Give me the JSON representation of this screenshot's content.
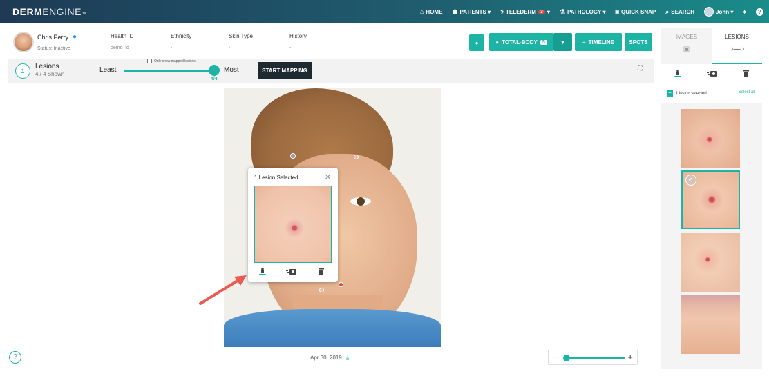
{
  "app": {
    "logo_bold": "DERM",
    "logo_light": "ENGINE",
    "logo_tm": "™"
  },
  "nav": {
    "items": [
      {
        "icon": "home-icon",
        "glyph": "⌂",
        "label": "HOME"
      },
      {
        "icon": "patients-icon",
        "glyph": "☗",
        "label": "PATIENTS ▾"
      },
      {
        "icon": "telederm-icon",
        "glyph": "⚕",
        "label": "TELEDERM",
        "badge": "3",
        "suffix": "▾"
      },
      {
        "icon": "pathology-icon",
        "glyph": "⚗",
        "label": "PATHOLOGY ▾"
      },
      {
        "icon": "camera-icon",
        "glyph": "◙",
        "label": "QUICK SNAP"
      },
      {
        "icon": "search-icon",
        "glyph": "⌕",
        "label": "SEARCH"
      }
    ],
    "user": "John ▾",
    "help": "?"
  },
  "patient": {
    "name": "Chris Perry",
    "status": "Status: Inactive",
    "fields": [
      {
        "label": "Health ID",
        "value": "demo_id"
      },
      {
        "label": "Ethnicity",
        "value": "-"
      },
      {
        "label": "Skin Type",
        "value": "-"
      },
      {
        "label": "History",
        "value": "-"
      }
    ]
  },
  "toolbar": {
    "total_body_label": "TOTAL-BODY",
    "total_body_count": "5",
    "timeline_label": "TIMELINE",
    "spots_label": "SPOTS"
  },
  "mapping": {
    "step": "1",
    "title": "Lesions",
    "subtitle": "4 / 4 Shown",
    "least": "Least",
    "most": "Most",
    "slider_value": "4/4",
    "only_mapped": "Only show mapped lesions",
    "start_button": "START MAPPING"
  },
  "popup": {
    "title": "1 Lesion Selected",
    "close": "✕"
  },
  "footer": {
    "help": "?",
    "date": "Apr 30, 2019",
    "zoom_minus": "−",
    "zoom_plus": "+",
    "zoom_level": 0.0
  },
  "right_panel": {
    "tab_images": "IMAGES",
    "tab_lesions": "LESIONS",
    "selected_text": "1 lesion selected",
    "select_all": "Select all"
  },
  "colors": {
    "accent": "#1db3a5",
    "nav_start": "#1e3a55",
    "nav_end": "#1a8c8a"
  }
}
